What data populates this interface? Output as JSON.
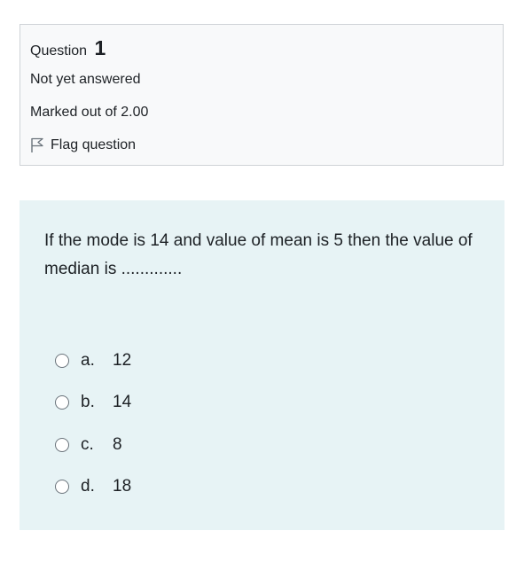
{
  "info": {
    "question_label": "Question",
    "question_number": "1",
    "state": "Not yet answered",
    "grade": "Marked out of 2.00",
    "flag_label": "Flag question",
    "flag_icon": "flag-icon"
  },
  "question": {
    "text": "If the mode is 14 and value of mean is 5 then the value of median is .............",
    "answers": [
      {
        "letter": "a.",
        "value": "12"
      },
      {
        "letter": "b.",
        "value": "14"
      },
      {
        "letter": "c.",
        "value": "8"
      },
      {
        "letter": "d.",
        "value": "18"
      }
    ]
  },
  "colors": {
    "info_background": "#f8f9fa",
    "content_background": "#e7f3f5",
    "border": "#cfd3d7"
  }
}
